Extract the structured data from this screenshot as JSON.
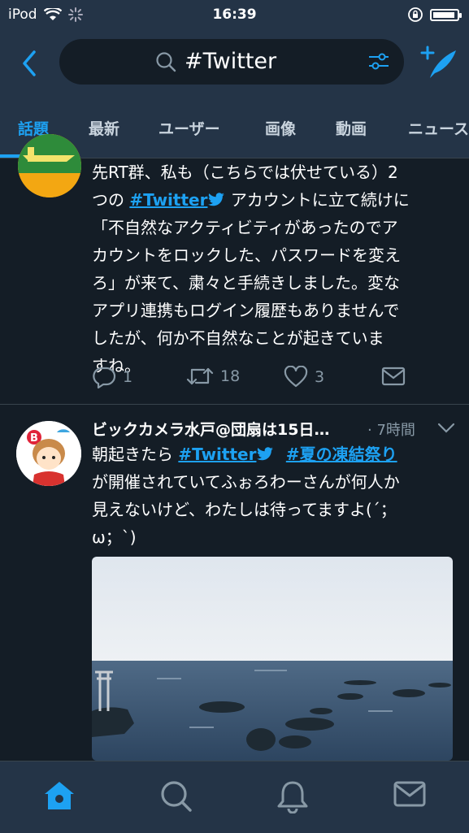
{
  "status_bar": {
    "carrier": "iPod",
    "time": "16:39",
    "battery_level": 0.92
  },
  "header": {
    "search_query": "#Twitter",
    "icons": [
      "back-icon",
      "search-icon",
      "filter-icon",
      "compose-icon"
    ]
  },
  "tabs": [
    {
      "label": "話題",
      "active": true
    },
    {
      "label": "最新"
    },
    {
      "label": "ユーザー"
    },
    {
      "label": "画像"
    },
    {
      "label": "動画"
    },
    {
      "label": "ニュース"
    }
  ],
  "tweet1": {
    "line1": "先RT群、私も（こちらでは伏せている）2",
    "line2_pre": "つの",
    "line2_hash": "#Twitter",
    "line2_post": "アカウントに立て続けに",
    "line3": "「不自然なアクティビティがあったのでア",
    "line4": "カウントをロックした、パスワードを変え",
    "line5": "ろ」が来て、粛々と手続きしました。変な",
    "line6": "アプリ連携もログイン履歴もありませんで",
    "line7": "したが、何か不自然なことが起きていま",
    "line8": "すね。",
    "replies": "1",
    "retweets": "18",
    "likes": "3"
  },
  "tweet2": {
    "name": "ビックカメラ水戸@団扇は15日…",
    "time": "· 7時間",
    "line1_pre": "朝起きたら",
    "hash1": "#Twitter",
    "hash2": "#夏の凍結祭り",
    "line2": "が開催されていてふぉろわーさんが何人か",
    "line3": "見えないけど、わたしは待ってますよ(´；",
    "line4": "ω；`)"
  },
  "colors": {
    "accent": "#1da1f2",
    "background": "#141d26",
    "bar": "#243447",
    "muted": "#8899a6"
  }
}
